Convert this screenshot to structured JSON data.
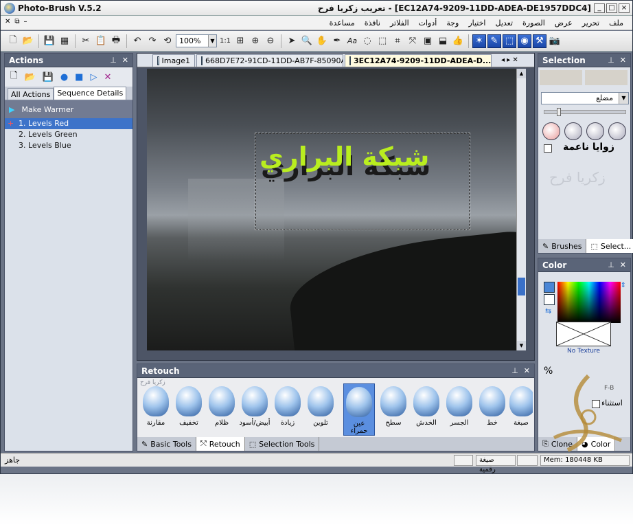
{
  "window": {
    "app_title": "Photo-Brush V.5.2",
    "doc_title": "تعريب زكريا فرح - [EC12A74-9209-11DD-ADEA-DE1957DDC4]",
    "buttons": {
      "minimize": "_",
      "maximize": "□",
      "close": "×"
    }
  },
  "menu": {
    "items": [
      "ملف",
      "تحرير",
      "عرض",
      "الصورة",
      "تعديل",
      "اختيار",
      "وجة",
      "أدوات",
      "الفلاتر",
      "نافذة",
      "مساعدة"
    ]
  },
  "toolbar": {
    "zoom_value": "100%",
    "ratio_label": "1:1"
  },
  "actions_panel": {
    "title": "Actions",
    "tabs": [
      "All Actions",
      "Sequence Details"
    ],
    "active_tab": "Sequence Details",
    "sequence_name": "Make Warmer",
    "steps": [
      "1. Levels Red",
      "2. Levels Green",
      "3. Levels Blue"
    ],
    "selected_step": "1. Levels Red"
  },
  "document": {
    "tabs": [
      "Image1",
      "668D7E72-91CD-11DD-AB7F-85090A...",
      "3EC12A74-9209-11DD-ADEA-D..."
    ],
    "active_tab": "3EC12A74-9209-11DD-ADEA-D...",
    "canvas_text": "شبكة البراري"
  },
  "retouch_panel": {
    "title": "Retouch",
    "section_label": "زكريا فرح",
    "brushes": [
      "مقارنة",
      "تخفيف",
      "ظلام",
      "أبيض/أسود",
      "زيادة",
      "تلوين",
      "عين حمراء",
      "سطح",
      "الخدش",
      "الجسر",
      "خط",
      "صبغة"
    ],
    "selected_brush": "عين حمراء",
    "bottom_tabs": [
      "Basic Tools",
      "Retouch",
      "Selection Tools"
    ],
    "active_bottom_tab": "Retouch"
  },
  "selection_panel": {
    "title": "Selection",
    "shape_value": "مضلع",
    "soft_corners_label": "زوايا ناعمة",
    "watermark_text": "زكريا فرح",
    "bottom_tabs": [
      "Brushes",
      "Select..."
    ]
  },
  "color_panel": {
    "title": "Color",
    "texture_label": "No Texture",
    "percent_label": "%",
    "exclusion_label": "استثناء",
    "fb_label": "F-B",
    "bottom_tabs": [
      "Clone",
      "Color"
    ],
    "accent_color": "#4a86d6"
  },
  "status": {
    "left_text": "جاهز",
    "mode_text": "صيغة رقمية",
    "memory_text": "Mem: 180448 KB"
  }
}
